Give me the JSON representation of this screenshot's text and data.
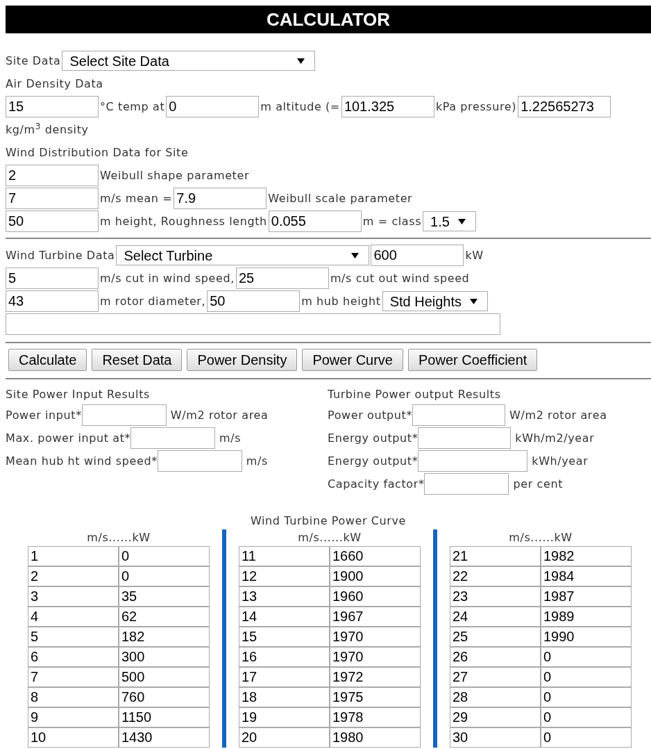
{
  "header": {
    "title": "CALCULATOR"
  },
  "site_data": {
    "lines": [
      [
        {
          "kind": "text",
          "text": "Site Data"
        },
        {
          "kind": "select_wide",
          "value": "Select Site Data"
        }
      ],
      [
        {
          "kind": "text",
          "text": "Air Density Data"
        }
      ],
      [
        {
          "kind": "input",
          "value": "15"
        },
        {
          "kind": "text",
          "text": "°C temp at"
        },
        {
          "kind": "input",
          "value": "0"
        },
        {
          "kind": "text",
          "text": "m altitude (="
        },
        {
          "kind": "input",
          "value": "101.325"
        },
        {
          "kind": "text",
          "text": "kPa pressure)"
        },
        {
          "kind": "input",
          "value": "1.22565273"
        }
      ],
      [
        {
          "kind": "text",
          "text": "kg/m$^{3}$ density"
        }
      ],
      [
        {
          "kind": "text",
          "text": "Wind Distribution Data for Site"
        }
      ],
      [
        {
          "kind": "input",
          "value": "2"
        },
        {
          "kind": "text",
          "text": "Weibull shape parameter"
        }
      ],
      [
        {
          "kind": "input",
          "value": "7"
        },
        {
          "kind": "text",
          "text": "m/s mean ="
        },
        {
          "kind": "input",
          "value": "7.9"
        },
        {
          "kind": "text",
          "text": "Weibull scale parameter"
        }
      ],
      [
        {
          "kind": "input",
          "value": "50"
        },
        {
          "kind": "text",
          "text": "m height, Roughness length"
        },
        {
          "kind": "input",
          "value": "0.055"
        },
        {
          "kind": "text",
          "text": "m = class"
        },
        {
          "kind": "select",
          "value": "1.5"
        }
      ]
    ]
  },
  "turbine_data": {
    "lines": [
      [
        {
          "kind": "text",
          "text": "Wind Turbine Data"
        },
        {
          "kind": "select_wide",
          "value": "Select Turbine"
        },
        {
          "kind": "input",
          "value": "600"
        },
        {
          "kind": "text",
          "text": "kW"
        }
      ],
      [
        {
          "kind": "input",
          "value": "5"
        },
        {
          "kind": "text",
          "text": "m/s cut in wind speed,"
        },
        {
          "kind": "input",
          "value": "25"
        },
        {
          "kind": "text",
          "text": "m/s cut out wind speed"
        }
      ],
      [
        {
          "kind": "input",
          "value": "43"
        },
        {
          "kind": "text",
          "text": "m rotor diameter,"
        },
        {
          "kind": "input",
          "value": "50"
        },
        {
          "kind": "text",
          "text": "m hub height"
        },
        {
          "kind": "select",
          "value": "Std Heights"
        }
      ],
      [
        {
          "kind": "wide_input"
        }
      ]
    ]
  },
  "buttons": [
    "Calculate",
    "Reset Data",
    "Power Density",
    "Power Curve",
    "Power Coefficient"
  ],
  "results": [
    {
      "title": "Site Power Input Results",
      "rows": [
        {
          "label": "Power input*",
          "unit": "W/m2 rotor area"
        },
        {
          "label": "Max. power input at*",
          "unit": "m/s"
        },
        {
          "label": "Mean hub ht wind speed*",
          "unit": "m/s"
        }
      ]
    },
    {
      "title": "Turbine Power output Results",
      "rows": [
        {
          "label": "Power output*",
          "unit": "W/m2 rotor area"
        },
        {
          "label": "Energy output*",
          "unit": "kWh/m2/year"
        },
        {
          "label": "Energy output*",
          "unit": "kWh/year"
        },
        {
          "label": "Capacity factor*",
          "unit": "per cent"
        }
      ]
    }
  ],
  "power_curve": {
    "title": "Wind Turbine Power Curve",
    "columns": [
      {
        "header": "m/s......kW",
        "rows": [
          [
            "1",
            "0"
          ],
          [
            "2",
            "0"
          ],
          [
            "3",
            "35"
          ],
          [
            "4",
            "62"
          ],
          [
            "5",
            "182"
          ],
          [
            "6",
            "300"
          ],
          [
            "7",
            "500"
          ],
          [
            "8",
            "760"
          ],
          [
            "9",
            "1150"
          ],
          [
            "10",
            "1430"
          ]
        ]
      },
      {
        "header": "m/s......kW",
        "rows": [
          [
            "11",
            "1660"
          ],
          [
            "12",
            "1900"
          ],
          [
            "13",
            "1960"
          ],
          [
            "14",
            "1967"
          ],
          [
            "15",
            "1970"
          ],
          [
            "16",
            "1970"
          ],
          [
            "17",
            "1972"
          ],
          [
            "18",
            "1975"
          ],
          [
            "19",
            "1978"
          ],
          [
            "20",
            "1980"
          ]
        ]
      },
      {
        "header": "m/s......kW",
        "rows": [
          [
            "21",
            "1982"
          ],
          [
            "22",
            "1984"
          ],
          [
            "23",
            "1987"
          ],
          [
            "24",
            "1989"
          ],
          [
            "25",
            "1990"
          ],
          [
            "26",
            "0"
          ],
          [
            "27",
            "0"
          ],
          [
            "28",
            "0"
          ],
          [
            "29",
            "0"
          ],
          [
            "30",
            "0"
          ]
        ]
      }
    ]
  }
}
